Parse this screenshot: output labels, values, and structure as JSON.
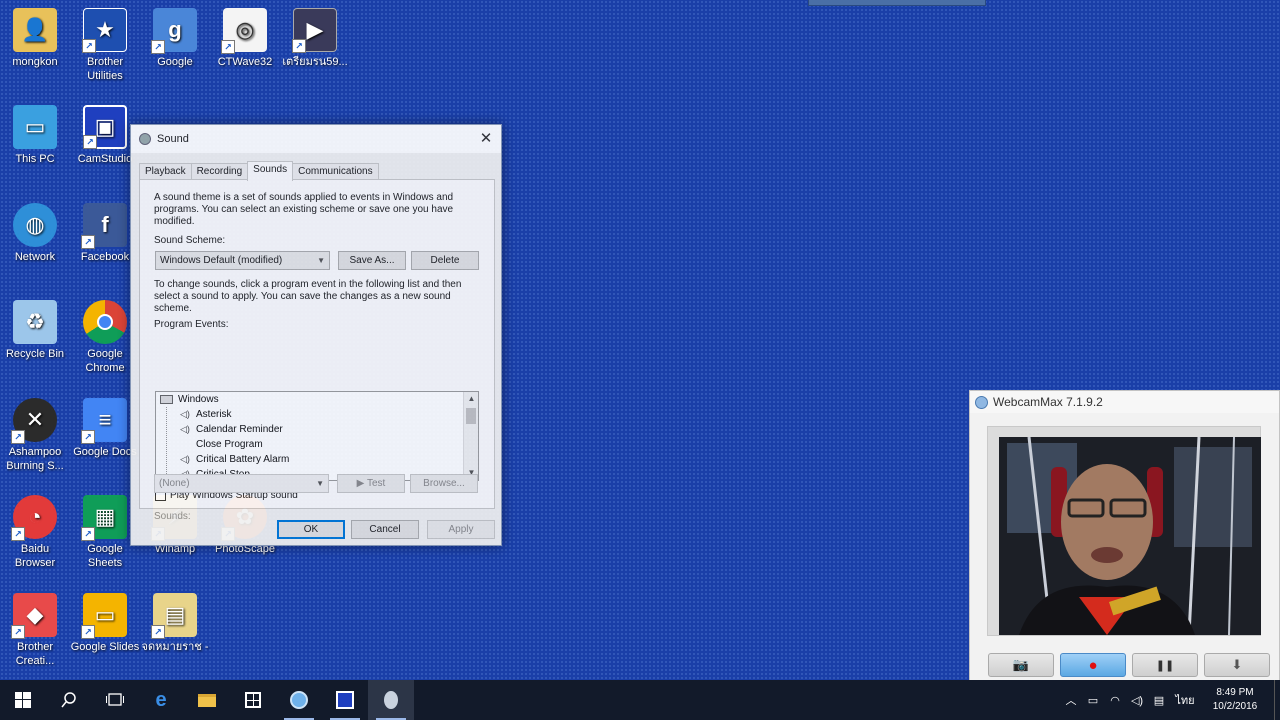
{
  "desktop": {
    "icons": [
      {
        "label": "mongkon",
        "icon": "user-folder-icon"
      },
      {
        "label": "Brother\nUtilities",
        "icon": "brother-utilities-icon"
      },
      {
        "label": "Google",
        "icon": "google-icon"
      },
      {
        "label": "CTWave32",
        "icon": "ctwave-icon"
      },
      {
        "label": "เตรียมรน59...",
        "icon": "video-thumbnail-icon"
      },
      {
        "label": "This PC",
        "icon": "computer-icon"
      },
      {
        "label": "CamStudio",
        "icon": "camstudio-icon"
      },
      {
        "label": "Network",
        "icon": "network-icon"
      },
      {
        "label": "Facebook",
        "icon": "facebook-icon"
      },
      {
        "label": "Recycle Bin",
        "icon": "recycle-bin-icon"
      },
      {
        "label": "Google\nChrome",
        "icon": "chrome-icon"
      },
      {
        "label": "Ashampoo\nBurning S...",
        "icon": "ashampoo-icon"
      },
      {
        "label": "Google Docs",
        "icon": "google-docs-icon"
      },
      {
        "label": "Baidu\nBrowser",
        "icon": "baidu-browser-icon"
      },
      {
        "label": "Google\nSheets",
        "icon": "google-sheets-icon"
      },
      {
        "label": "Winamp",
        "icon": "winamp-icon"
      },
      {
        "label": "PhotoScape",
        "icon": "photoscape-icon"
      },
      {
        "label": "Brother\nCreati...",
        "icon": "brother-creative-icon"
      },
      {
        "label": "Google Slides",
        "icon": "google-slides-icon"
      },
      {
        "label": "จดหมายราช -",
        "icon": "document-folder-icon"
      }
    ]
  },
  "sound_dialog": {
    "title": "Sound",
    "close_glyph": "✕",
    "tabs": [
      "Playback",
      "Recording",
      "Sounds",
      "Communications"
    ],
    "active_tab": "Sounds",
    "intro_text": "A sound theme is a set of sounds applied to events in Windows and programs.  You can select an existing scheme or save one you have modified.",
    "scheme_label": "Sound Scheme:",
    "scheme_value": "Windows Default (modified)",
    "save_as_label": "Save As...",
    "delete_label": "Delete",
    "instructions_text": "To change sounds, click a program event in the following list and then select a sound to apply.  You can save the changes as a new sound scheme.",
    "events_label": "Program Events:",
    "events": [
      {
        "label": "Windows",
        "group": true
      },
      {
        "label": "Asterisk",
        "group": false
      },
      {
        "label": "Calendar Reminder",
        "group": false
      },
      {
        "label": "Close Program",
        "group": false
      },
      {
        "label": "Critical Battery Alarm",
        "group": false
      },
      {
        "label": "Critical Stop",
        "group": false
      }
    ],
    "startup_checkbox_label": "Play Windows Startup sound",
    "startup_checked": false,
    "sounds_label": "Sounds:",
    "sounds_value": "(None)",
    "test_label": "▶ Test",
    "browse_label": "Browse...",
    "ok_label": "OK",
    "cancel_label": "Cancel",
    "apply_label": "Apply"
  },
  "webcam": {
    "title": "WebcamMax  7.1.9.2",
    "toolbar": [
      {
        "name": "snapshot",
        "glyph": "📷"
      },
      {
        "name": "record",
        "glyph": "●"
      },
      {
        "name": "pause",
        "glyph": "❚❚"
      },
      {
        "name": "download",
        "glyph": "⬇"
      }
    ]
  },
  "taskbar": {
    "tray_lang": "ไทย",
    "time": "8:49 PM",
    "date": "10/2/2016"
  },
  "colors": {
    "desktop_bg": "#1a3fa8",
    "accent": "#0078d7",
    "record_red": "#e01010"
  }
}
